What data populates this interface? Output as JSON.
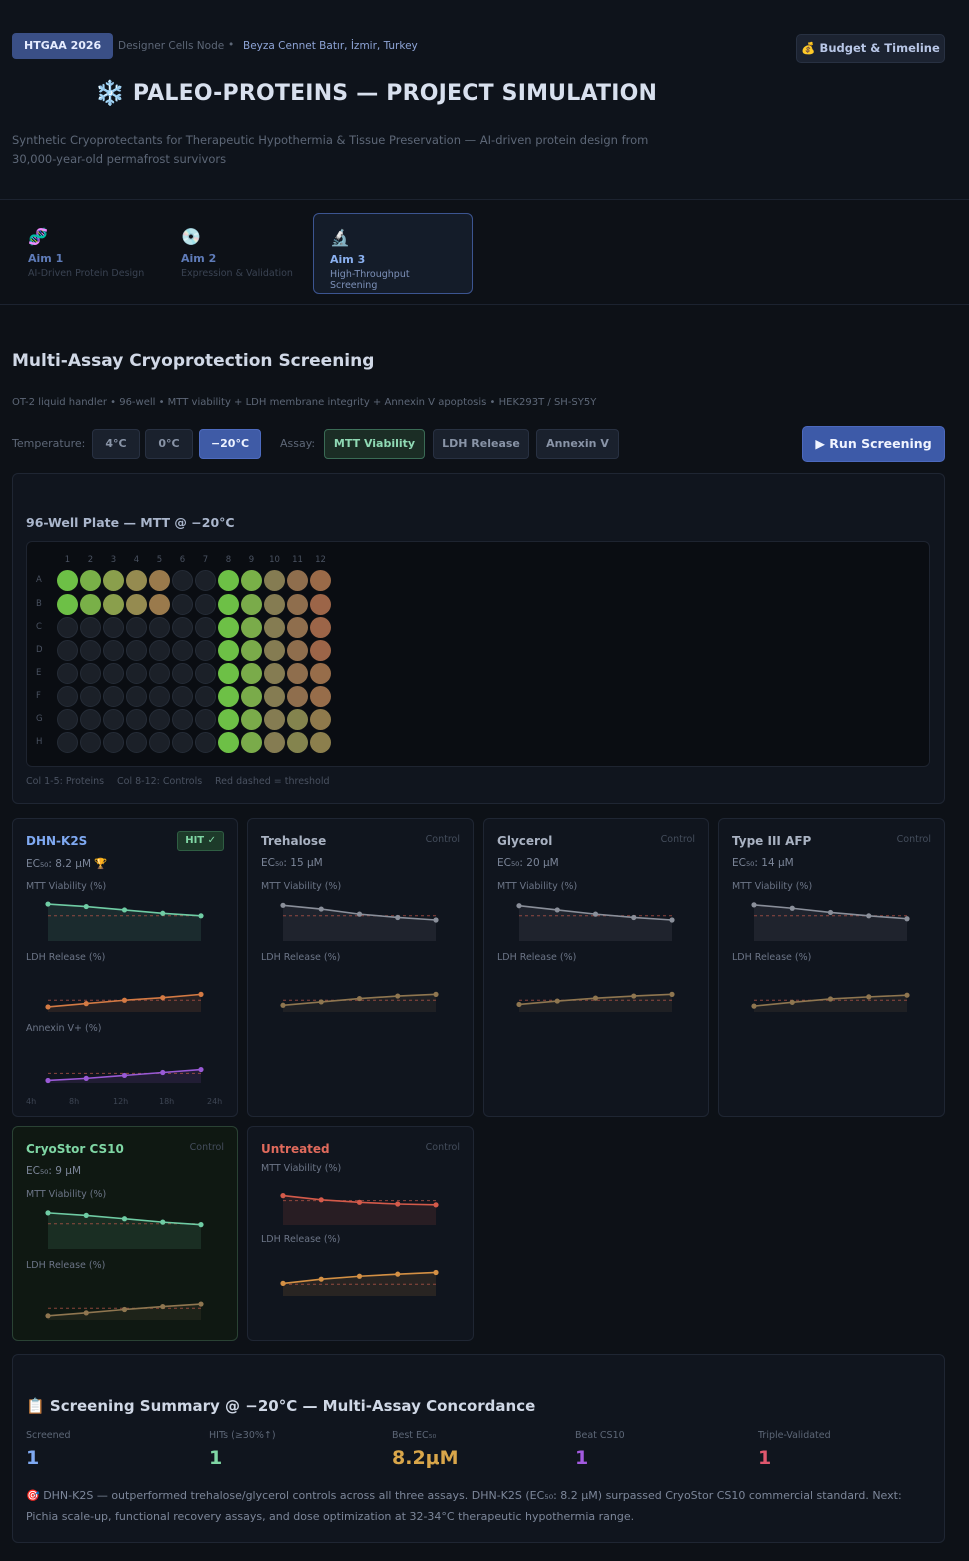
{
  "header": {
    "badge": "HTGAA 2026",
    "node": "Designer Cells Node",
    "separator": "•",
    "author": "Beyza Cennet Batır, İzmir, Turkey",
    "budget_button": "💰 Budget & Timeline",
    "title_icon": "❄️",
    "title": "PALEO-PROTEINS — PROJECT SIMULATION",
    "subtitle": "Synthetic Cryoprotectants for Therapeutic Hypothermia & Tissue Preservation — AI-driven protein design from 30,000-year-old permafrost survivors"
  },
  "tabs": [
    {
      "icon": "🧬",
      "label": "Aim 1",
      "sub": "AI-Driven Protein Design"
    },
    {
      "icon": "💿",
      "label": "Aim 2",
      "sub": "Expression & Validation"
    },
    {
      "icon": "🔬",
      "label": "Aim 3",
      "sub": "High-Throughput Screening",
      "active": true
    }
  ],
  "section": {
    "title": "Multi-Assay Cryoprotection Screening",
    "subtitle": "OT-2 liquid handler • 96-well • MTT viability + LDH membrane integrity + Annexin V apoptosis • HEK293T / SH-SY5Y",
    "temp_label": "Temperature:",
    "temps": [
      "4°C",
      "0°C",
      "−20°C"
    ],
    "selected_temp": "−20°C",
    "assay_label": "Assay:",
    "assays": [
      "MTT Viability",
      "LDH Release",
      "Annexin V"
    ],
    "selected_assay": "MTT Viability",
    "run_button": "▶ Run Screening"
  },
  "plate": {
    "title": "96-Well Plate — MTT @ −20°C",
    "columns": [
      "1",
      "2",
      "3",
      "4",
      "5",
      "6",
      "7",
      "8",
      "9",
      "10",
      "11",
      "12"
    ],
    "rows": [
      "A",
      "B",
      "C",
      "D",
      "E",
      "F",
      "G",
      "H"
    ],
    "legend": [
      "Col 1-5: Proteins",
      "Col 8-12: Controls",
      "Red dashed = threshold"
    ],
    "filled_protein_rows": [
      "A",
      "B"
    ],
    "well_colors": {
      "empty": "#1b2028",
      "protein": [
        "#6dc046",
        "#79b048",
        "#8a9f4c",
        "#958b50",
        "#9a7a4c"
      ],
      "controls": {
        "A": [
          "#6dc046",
          "#79b048",
          "#857c52",
          "#8f6e4d",
          "#9a6a48"
        ],
        "B": [
          "#6dc046",
          "#7aab4a",
          "#857c52",
          "#8f6e4d",
          "#9c6548"
        ],
        "C": [
          "#6dc046",
          "#7aab4a",
          "#857c52",
          "#8f6e4d",
          "#9c6548"
        ],
        "D": [
          "#6dc046",
          "#7aab4a",
          "#857c52",
          "#8f6e4d",
          "#9c6548"
        ],
        "E": [
          "#6dc046",
          "#7aab4a",
          "#857c52",
          "#8f6e4d",
          "#976d4a"
        ],
        "F": [
          "#6dc046",
          "#7aab4a",
          "#857c52",
          "#8f6e4d",
          "#976d4a"
        ],
        "G": [
          "#6dc046",
          "#7aab4a",
          "#857c52",
          "#84844e",
          "#8f7a4c"
        ],
        "H": [
          "#6dc046",
          "#7aab4a",
          "#857c52",
          "#84844e",
          "#8c7f4d"
        ]
      }
    }
  },
  "cards": [
    {
      "name": "DHN-K2S",
      "badge": "HIT ✓",
      "ec50": "EC₅₀: 8.2 μM 🏆",
      "highlight": false,
      "name_color": "#7fa9f2",
      "charts": [
        {
          "label": "MTT Viability (%)",
          "color": "#6fcca4",
          "values": [
            88,
            82,
            74,
            66,
            60
          ],
          "threshold": 60
        },
        {
          "label": "LDH Release (%)",
          "color": "#d47a44",
          "values": [
            12,
            20,
            28,
            34,
            42
          ],
          "threshold": 28
        },
        {
          "label": "Annexin V+ (%)",
          "color": "#9a5ad6",
          "values": [
            6,
            11,
            18,
            25,
            32
          ],
          "threshold": 23
        }
      ],
      "axis": [
        "4h",
        "8h",
        "12h",
        "18h",
        "24h"
      ]
    },
    {
      "name": "Trehalose",
      "tag": "Control",
      "ec50": "EC₅₀: 15 μM",
      "name_color": "#a9b2c2",
      "charts": [
        {
          "label": "MTT Viability (%)",
          "color": "#8a8f9a",
          "values": [
            85,
            76,
            64,
            56,
            50
          ],
          "threshold": 60
        },
        {
          "label": "LDH Release (%)",
          "color": "#8f7650",
          "values": [
            16,
            24,
            32,
            38,
            42
          ],
          "threshold": 28
        }
      ]
    },
    {
      "name": "Glycerol",
      "tag": "Control",
      "ec50": "EC₅₀: 20 μM",
      "name_color": "#a9b2c2",
      "charts": [
        {
          "label": "MTT Viability (%)",
          "color": "#8a8f9a",
          "values": [
            84,
            74,
            64,
            56,
            50
          ],
          "threshold": 60
        },
        {
          "label": "LDH Release (%)",
          "color": "#8f7650",
          "values": [
            18,
            26,
            33,
            38,
            42
          ],
          "threshold": 28
        }
      ]
    },
    {
      "name": "Type III AFP",
      "tag": "Control",
      "ec50": "EC₅₀: 14 μM",
      "name_color": "#a9b2c2",
      "charts": [
        {
          "label": "MTT Viability (%)",
          "color": "#8a8f9a",
          "values": [
            86,
            78,
            68,
            60,
            53
          ],
          "threshold": 60
        },
        {
          "label": "LDH Release (%)",
          "color": "#8f7650",
          "values": [
            14,
            23,
            31,
            36,
            40
          ],
          "threshold": 28
        }
      ]
    },
    {
      "name": "CryoStor CS10",
      "tag": "Control",
      "ec50": "EC₅₀: 9 μM",
      "highlight": true,
      "name_color": "#7fd6a4",
      "charts": [
        {
          "label": "MTT Viability (%)",
          "color": "#6fcca4",
          "values": [
            86,
            80,
            72,
            64,
            58
          ],
          "threshold": 60
        },
        {
          "label": "LDH Release (%)",
          "color": "#8f7650",
          "values": [
            10,
            17,
            25,
            32,
            38
          ],
          "threshold": 28
        }
      ]
    },
    {
      "name": "Untreated",
      "tag": "Control",
      "ec50": "",
      "name_color": "#e06a5c",
      "charts": [
        {
          "label": "MTT Viability (%)",
          "color": "#d45a4a",
          "values": [
            70,
            60,
            54,
            50,
            48
          ],
          "threshold": 58
        },
        {
          "label": "LDH Release (%)",
          "color": "#d49044",
          "values": [
            30,
            40,
            47,
            52,
            56
          ],
          "threshold": 28
        }
      ]
    }
  ],
  "summary": {
    "title": "📋 Screening Summary @ −20°C — Multi-Assay Concordance",
    "stats": [
      {
        "label": "Screened",
        "value": "1",
        "color": "#7fa9f2"
      },
      {
        "label": "HITs (≥30%↑)",
        "value": "1",
        "color": "#7fd6a4"
      },
      {
        "label": "Best EC₅₀",
        "value": "8.2μM",
        "color": "#d9a64a"
      },
      {
        "label": "Beat CS10",
        "value": "1",
        "color": "#a35ae0"
      },
      {
        "label": "Triple-Validated",
        "value": "1",
        "color": "#e0576e"
      }
    ],
    "text": "🎯 DHN-K2S — outperformed trehalose/glycerol controls across all three assays. DHN-K2S (EC₅₀: 8.2 μM) surpassed CryoStor CS10 commercial standard. Next: Pichia scale-up, functional recovery assays, and dose optimization at 32-34°C therapeutic hypothermia range."
  }
}
